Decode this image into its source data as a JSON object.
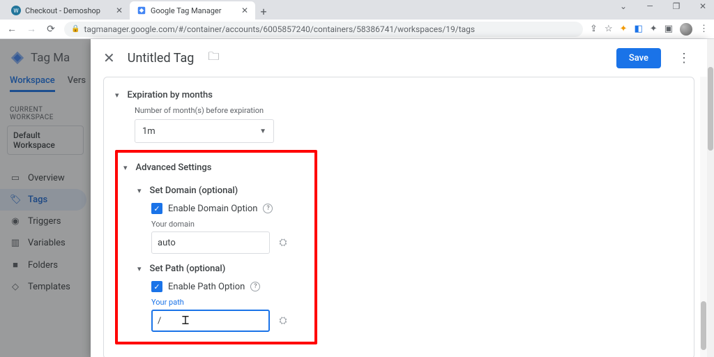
{
  "browser": {
    "tabs": [
      {
        "title": "Checkout - Demoshop",
        "favicon": "wp"
      },
      {
        "title": "Google Tag Manager",
        "favicon": "gtm"
      }
    ],
    "url": "tagmanager.google.com/#/container/accounts/6005857240/containers/58386741/workspaces/19/tags"
  },
  "gtm": {
    "brand": "Tag Ma",
    "top_tabs": {
      "workspace": "Workspace",
      "versions": "Vers"
    },
    "ws_label": "CURRENT WORKSPACE",
    "ws_name": "Default Workspace",
    "nav": {
      "overview": "Overview",
      "tags": "Tags",
      "triggers": "Triggers",
      "variables": "Variables",
      "folders": "Folders",
      "templates": "Templates"
    }
  },
  "panel": {
    "title": "Untitled Tag",
    "save": "Save"
  },
  "form": {
    "expiration": {
      "title": "Expiration by months",
      "hint": "Number of month(s) before expiration",
      "value": "1m"
    },
    "advanced_title": "Advanced Settings",
    "domain": {
      "title": "Set Domain (optional)",
      "checkbox": "Enable Domain Option",
      "label": "Your domain",
      "value": "auto"
    },
    "path": {
      "title": "Set Path (optional)",
      "checkbox": "Enable Path Option",
      "label": "Your path",
      "value": "/"
    }
  }
}
